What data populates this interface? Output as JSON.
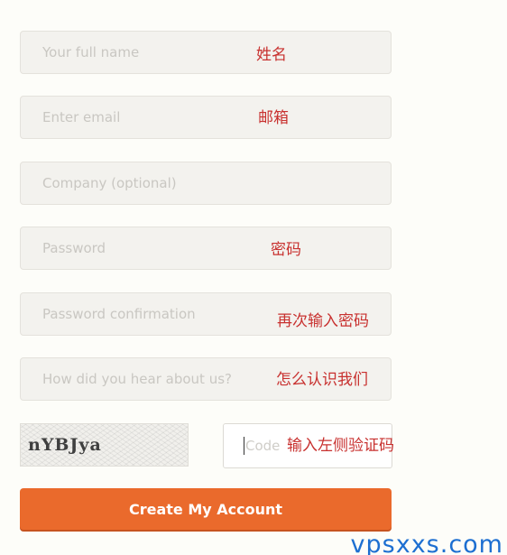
{
  "form": {
    "full_name": {
      "placeholder": "Your full name",
      "note": "姓名"
    },
    "email": {
      "placeholder": "Enter email",
      "note": "邮箱"
    },
    "company": {
      "placeholder": "Company (optional)"
    },
    "password": {
      "placeholder": "Password",
      "note": "密码"
    },
    "password_confirmation": {
      "placeholder": "Password confirmation",
      "note": "再次输入密码"
    },
    "referral": {
      "placeholder": "How did you hear about us?",
      "note": "怎么认识我们"
    },
    "captcha": {
      "image_text": "nYBJya"
    },
    "code": {
      "placeholder": "Code",
      "note": "输入左侧验证码"
    },
    "submit_label": "Create My Account"
  },
  "watermark": "vpsxxs.com",
  "colors": {
    "accent": "#ea6a2c",
    "annotation": "#c8312f",
    "watermark": "#1d6fd1"
  }
}
